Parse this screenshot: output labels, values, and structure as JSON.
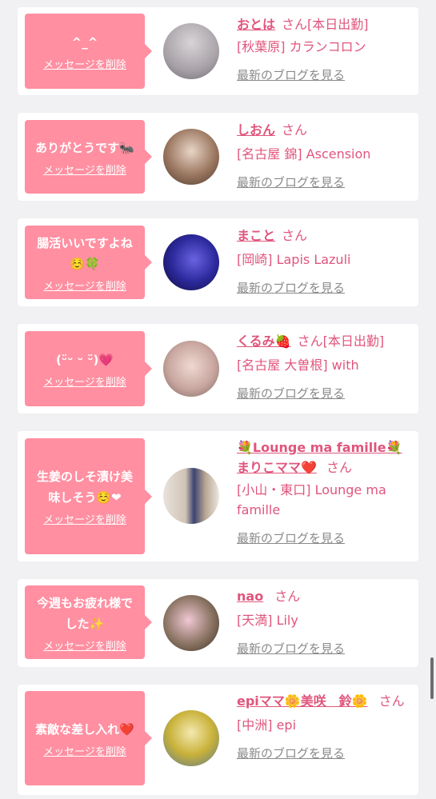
{
  "cards": [
    {
      "message": "^_^",
      "delete_label": "メッセージを削除",
      "name": "おとは",
      "honorific": "さん",
      "status": "[本日出勤]",
      "shop": "[秋葉原] カランコロン",
      "blog_link": "最新のブログを見る",
      "avatar_color": "#a8a2a8"
    },
    {
      "message": "ありがとうです🐜",
      "delete_label": "メッセージを削除",
      "name": "しおん",
      "honorific": "さん",
      "shop": "[名古屋 錦] Ascension",
      "blog_link": "最新のブログを見る",
      "avatar_color": "#7a5a48"
    },
    {
      "message": "腸活いいですよね ☺️🍀",
      "delete_label": "メッセージを削除",
      "name": "まこと",
      "honorific": "さん",
      "shop": "[岡崎] Lapis Lazuli",
      "blog_link": "最新のブログを見る",
      "avatar_color": "#2d2a9e"
    },
    {
      "message": "(ᵕ̈ᵕ ᵕ ᵕ̈)💗",
      "delete_label": "メッセージを削除",
      "name": "くるみ🍓",
      "honorific": "さん",
      "status": "[本日出勤]",
      "shop": "[名古屋 大曽根] with",
      "blog_link": "最新のブログを見る",
      "avatar_color": "#c9a7a0"
    },
    {
      "message": "生姜のしそ漬け美味しそう☺️❤",
      "delete_label": "メッセージを削除",
      "name_line1": "💐Lounge ma famille💐",
      "name_line2": "まりこママ❤️",
      "honorific": "さん",
      "shop": "[小山・東口] Lounge ma famille",
      "blog_link": "最新のブログを見る",
      "avatar_color": "#b8a592"
    },
    {
      "message": "今週もお疲れ様でした✨",
      "delete_label": "メッセージを削除",
      "name": "nao",
      "honorific": "さん",
      "shop": "[天満] Lily",
      "blog_link": "最新のブログを見る",
      "avatar_color": "#8a7362"
    },
    {
      "message": "素敵な差し入れ❤️",
      "delete_label": "メッセージを削除",
      "name": "epiママ🌼美咲　鈴🌼",
      "honorific": "さん",
      "shop": "[中洲] epi",
      "blog_link": "最新のブログを見る",
      "avatar_color": "#c9b23a"
    }
  ]
}
